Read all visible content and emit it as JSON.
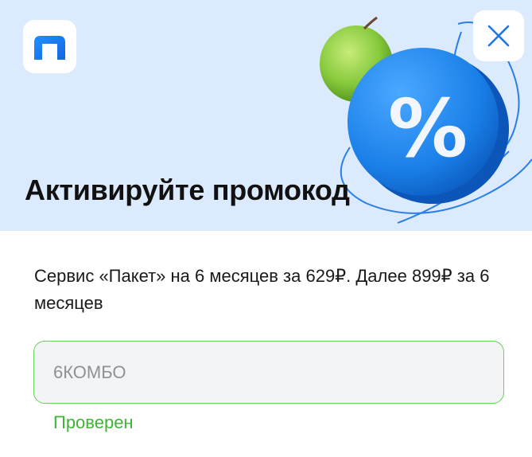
{
  "hero": {
    "title": "Активируйте промокод",
    "background_color": "#dbeafc",
    "logo_icon": "service-logo-icon",
    "close_icon": "close-icon",
    "decoration": [
      "apple",
      "percent-badge"
    ]
  },
  "offer": {
    "description": "Сервис «Пакет» на 6 месяцев за 629₽. Далее 899₽ за 6 месяцев"
  },
  "promo_code": {
    "value": "6КОМБО",
    "status": "Проверен",
    "accent_color": "#3fb435"
  }
}
